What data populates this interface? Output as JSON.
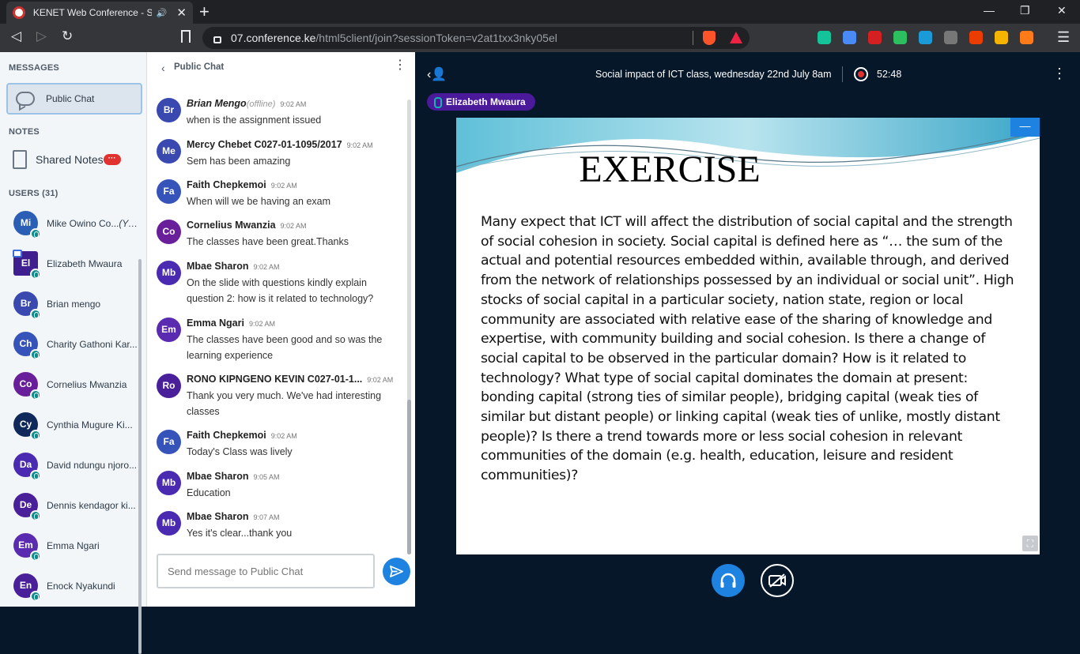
{
  "browser": {
    "tab_title": "KENET Web Conference - Soci",
    "tab_audio": "🔊",
    "tab_close": "✕",
    "new_tab": "+",
    "minimize": "—",
    "restore": "❐",
    "close": "✕",
    "back": "◁",
    "forward": "▷",
    "reload": "↻",
    "url_host": "07.conference.ke",
    "url_path": "/html5client/join?sessionToken=v2at1txx3nky05el",
    "extensions": [
      {
        "name": "grammarly-icon",
        "color": "#15c39a"
      },
      {
        "name": "translate-icon",
        "color": "#4a8af4"
      },
      {
        "name": "pdf-icon",
        "color": "#d42020"
      },
      {
        "name": "evernote-icon",
        "color": "#2dbe60"
      },
      {
        "name": "extension-badge-icon",
        "color": "#1a9bd7"
      },
      {
        "name": "font-icon",
        "color": "#777777"
      },
      {
        "name": "office-icon",
        "color": "#eb3c00"
      },
      {
        "name": "drive-icon",
        "color": "#f4b400"
      },
      {
        "name": "fox-icon",
        "color": "#ff7a18"
      }
    ],
    "menu": "☰"
  },
  "left": {
    "messages_label": "MESSAGES",
    "public_chat": "Public Chat",
    "notes_label": "NOTES",
    "shared_notes": "Shared Notes",
    "notes_badge": "···",
    "users_label": "USERS (31)",
    "users": [
      {
        "initials": "Mi",
        "name": "Mike Owino Co...",
        "suffix": "(You)",
        "color": "#2a5fb5",
        "square": false,
        "presenter": false
      },
      {
        "initials": "El",
        "name": "Elizabeth Mwaura",
        "suffix": "",
        "color": "#3f1f8f",
        "square": true,
        "presenter": true
      },
      {
        "initials": "Br",
        "name": "Brian mengo",
        "suffix": "",
        "color": "#3a49b0",
        "square": false,
        "presenter": false
      },
      {
        "initials": "Ch",
        "name": "Charity Gathoni Kar...",
        "suffix": "",
        "color": "#3553b8",
        "square": false,
        "presenter": false
      },
      {
        "initials": "Co",
        "name": "Cornelius Mwanzia",
        "suffix": "",
        "color": "#6a1f9a",
        "square": false,
        "presenter": false
      },
      {
        "initials": "Cy",
        "name": "Cynthia Mugure Ki...",
        "suffix": "",
        "color": "#0f2a5a",
        "square": false,
        "presenter": false
      },
      {
        "initials": "Da",
        "name": "David ndungu njoro...",
        "suffix": "",
        "color": "#4a2ab0",
        "square": false,
        "presenter": false
      },
      {
        "initials": "De",
        "name": "Dennis kendagor ki...",
        "suffix": "",
        "color": "#4a1f9a",
        "square": false,
        "presenter": false
      },
      {
        "initials": "Em",
        "name": "Emma Ngari",
        "suffix": "",
        "color": "#5a2ab0",
        "square": false,
        "presenter": false
      },
      {
        "initials": "En",
        "name": "Enock Nyakundi",
        "suffix": "",
        "color": "#4a1f9a",
        "square": false,
        "presenter": false
      }
    ]
  },
  "chat": {
    "back": "‹",
    "title": "Public Chat",
    "menu": "⋮",
    "input_placeholder": "Send message to Public Chat",
    "messages": [
      {
        "initials": "Br",
        "color": "#3a49b0",
        "name": "Brian Mengo",
        "offline": "(offline)",
        "time": "9:02 AM",
        "text": "when is the assignment issued",
        "height": 52
      },
      {
        "initials": "Me",
        "color": "#3a49b0",
        "name": "Mercy Chebet C027-01-1095/2017",
        "offline": "",
        "time": "9:02 AM",
        "text": "Sem has been amazing",
        "height": 51
      },
      {
        "initials": "Fa",
        "color": "#3553b8",
        "name": "Faith Chepkemoi",
        "offline": "",
        "time": "9:02 AM",
        "text": "When will we be having an exam",
        "height": 51
      },
      {
        "initials": "Co",
        "color": "#6a1f9a",
        "name": "Cornelius Mwanzia",
        "offline": "",
        "time": "9:02 AM",
        "text": "The classes have been great.Thanks",
        "height": 52
      },
      {
        "initials": "Mb",
        "color": "#4a2ab0",
        "name": "Mbae Sharon",
        "offline": "",
        "time": "9:02 AM",
        "text": "On the slide with questions kindly explain question 2: how is it related to technology?",
        "height": 72
      },
      {
        "initials": "Em",
        "color": "#5a2ab0",
        "name": "Emma Ngari",
        "offline": "",
        "time": "9:02 AM",
        "text": "The classes have been good and so was the learning experience",
        "height": 71
      },
      {
        "initials": "Ro",
        "color": "#4a1f9a",
        "name": "RONO KIPNGENO KEVIN C027-01-1...",
        "offline": "",
        "time": "9:02 AM",
        "text": "Thank you very much. We've had interesting classes",
        "height": 71
      },
      {
        "initials": "Fa",
        "color": "#3553b8",
        "name": "Faith Chepkemoi",
        "offline": "",
        "time": "9:02 AM",
        "text": "Today's Class was lively",
        "height": 52
      },
      {
        "initials": "Mb",
        "color": "#4a2ab0",
        "name": "Mbae Sharon",
        "offline": "",
        "time": "9:05 AM",
        "text": "Education",
        "height": 51
      },
      {
        "initials": "Mb",
        "color": "#4a2ab0",
        "name": "Mbae Sharon",
        "offline": "",
        "time": "9:07 AM",
        "text": "Yes it's clear...thank you",
        "height": 51
      }
    ]
  },
  "main": {
    "user_toggle": "‹👤",
    "title": "Social impact of ICT class, wednesday 22nd July 8am",
    "rec_time": "52:48",
    "menu": "⋮",
    "talker": "Elizabeth Mwaura",
    "slide_title": "EXERCISE",
    "slide_body": "Many expect that ICT will affect the distribution of social capital and the strength of social cohesion in society. Social capital is defined here as “… the sum of the actual and potential resources embedded within, available through, and derived from the network of relationships possessed by an individual or social unit”. High stocks of social capital in a particular society, nation state, region or local community are associated with relative ease of the sharing of knowledge and expertise, with community building and social cohesion. Is there a change of social capital to be observed in the particular domain? How is it related to technology? What type of social capital dominates the domain at present: bonding capital (strong ties of similar people), bridging capital (weak ties of similar but distant people) or linking capital (weak ties of unlike, mostly distant people)? Is there a trend towards more or less social cohesion in relevant communities of the domain (e.g. health, education, leisure and resident communities)?",
    "minimize": "—",
    "fullscreen": "⛶"
  }
}
